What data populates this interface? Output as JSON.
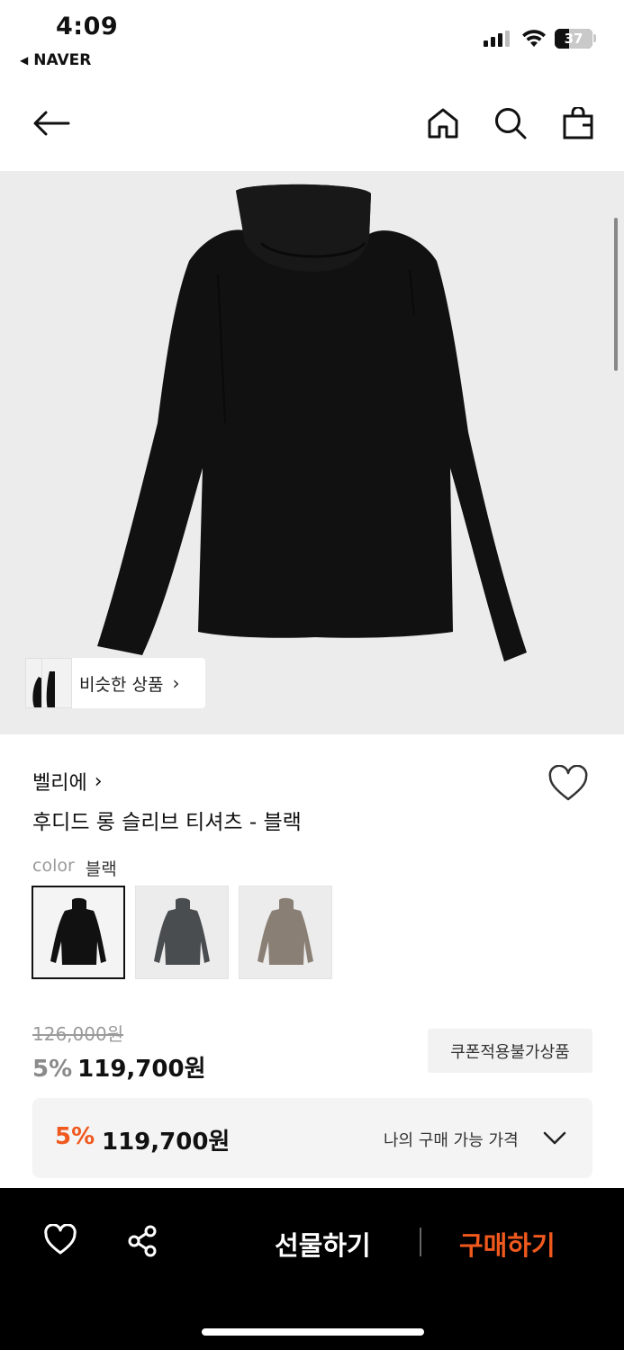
{
  "status_bar": {
    "time": "4:09",
    "back_app": "NAVER",
    "battery": "37",
    "battery_level": 0.37
  },
  "header": {
    "icons": [
      "back-arrow-icon",
      "home-icon",
      "search-icon",
      "shopping-bag-icon"
    ]
  },
  "hero": {
    "similar_label": "비슷한 상품",
    "similar_chevron": "›"
  },
  "product": {
    "brand": "벨리에",
    "brand_chevron": "›",
    "name": "후디드 롱 슬리브 티셔츠 - 블랙",
    "color_label": "color",
    "color_value": "블랙",
    "swatch_colors": [
      "#111111",
      "#4a4d50",
      "#8a7f75"
    ],
    "original_price": "126,000원",
    "discount": "5%",
    "price": "119,700원",
    "coupon_badge": "쿠폰적용불가상품"
  },
  "my_price": {
    "discount": "5%",
    "price": "119,700원",
    "label": "나의 구매 가능 가격"
  },
  "bottom_bar": {
    "gift_label": "선물하기",
    "buy_label": "구매하기"
  },
  "colors": {
    "accent": "#f0591e",
    "hero_bg": "#ececec",
    "bar_bg": "#000000"
  }
}
